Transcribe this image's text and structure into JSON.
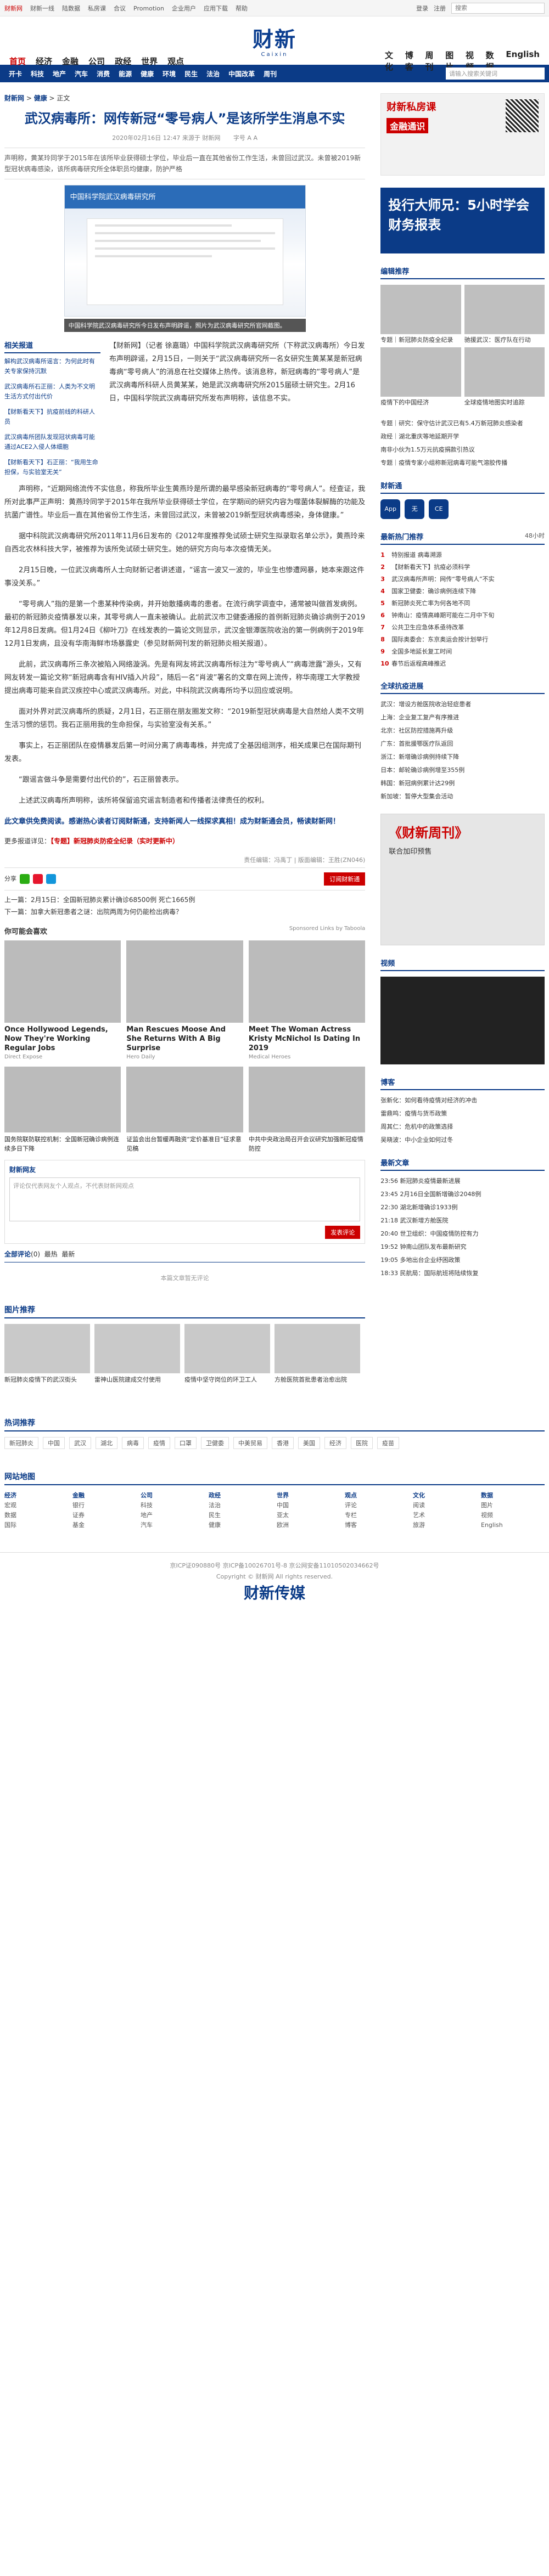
{
  "topbar": {
    "links": [
      "财新网",
      "财新一线",
      "陆数据",
      "私房课",
      "合议",
      "Promotion",
      "企业用户",
      "应用下载",
      "帮助"
    ],
    "login": "登录",
    "register": "注册",
    "search_placeholder": "搜索"
  },
  "logo": {
    "cn": "财新",
    "en": "Caixin"
  },
  "nav": {
    "left": [
      "首页",
      "经济",
      "金融",
      "公司",
      "政经",
      "世界",
      "观点"
    ],
    "right": [
      "文化",
      "博客",
      "周刊",
      "图片",
      "视频",
      "数据",
      "English"
    ]
  },
  "subnav": {
    "items": [
      "开卡",
      "科技",
      "地产",
      "汽车",
      "消费",
      "能源",
      "健康",
      "环境",
      "民生",
      "法治",
      "中国改革",
      "周刊"
    ],
    "search_placeholder": "请输入搜索关键词"
  },
  "crumb": {
    "site": "财新网",
    "sep1": " > ",
    "section": "健康",
    "sep2": " > ",
    "sub": "正文"
  },
  "article": {
    "title": "武汉病毒所：网传新冠“零号病人”是该所学生消息不实",
    "meta": "2020年02月16日 12:47 来源于 财新网",
    "zoom": "字号 A A",
    "summary": "声明称，黄某玲同学于2015年在该所毕业获得硕士学位，毕业后一直在其他省份工作生活，未曾回过武汉。未曾被2019新型冠状病毒感染，该所病毒研究所全体职员均健康，防护严格",
    "photo_banner": "中国科学院武汉病毒研究所",
    "caption": "中国科学院武汉病毒研究所今日发布声明辟谣，照片为武汉病毒研究所官网截图。",
    "lead": "【财新网】（记者 徐嘉璐）中国科学院武汉病毒研究所（下称武汉病毒所）今日发布声明辟谣，2月15日，一则关于“武汉病毒研究所一名女研究生黄某某是新冠病毒病“零号病人”的消息在社交媒体上热传。该消息称，新冠病毒的“零号病人”是武汉病毒所科研人员黄某某，她是武汉病毒研究所2015届硕士研究生。2月16日，中国科学院武汉病毒研究所发布声明称，该信息不实。",
    "paragraphs": [
      "声明称，“近期网络流传不实信息，称我所毕业生黄燕玲是所谓的最早感染新冠病毒的“零号病人”。经查证，我所对此事严正声明：黄燕玲同学于2015年在我所毕业获得硕士学位，在学期间的研究内容为噬菌体裂解酶的功能及抗菌广谱性。毕业后一直在其他省份工作生活，未曾回过武汉，未曾被2019新型冠状病毒感染，身体健康。”",
      "据中科院武汉病毒研究所2011年11月6日发布的《2012年度推荐免试硕士研究生拟录取名单公示》，黄燕玲来自西北农林科技大学，被推荐为该所免试硕士研究生。她的研究方向与本次疫情无关。",
      "2月15日晚，一位武汉病毒所人士向财新记者讲述道，“谣言一波又一波的，毕业生也惨遭网暴，她本来跟这件事没关系。”",
      "“零号病人”指的是第一个患某种传染病，并开始散播病毒的患者。在流行病学调查中，通常被叫做首发病例。最初的新冠肺炎疫情暴发以来，其零号病人一直未被确认。此前武汉市卫健委通报的首例新冠肺炎确诊病例于2019年12月8日发病。但1月24日《柳叶刀》在线发表的一篇论文则显示，武汉金银潭医院收治的第一例病例于2019年12月1日发病，且没有华南海鲜市场暴露史（参见财新网刊发的新冠肺炎相关报道）。",
      "此前，武汉病毒所三条次被陷入网络漩涡。先是有网友将武汉病毒所标注为“零号病人”“病毒泄露”源头，又有网友转发一篇论文称“新冠病毒含有HIV插入片段”，随后一名“肖波”署名的文章在网上流传，称华南理工大学教授提出病毒可能来自武汉疾控中心或武汉病毒所。对此，中科院武汉病毒所均予以回应或说明。",
      "面对外界对武汉病毒所的质疑，2月1日，石正丽在朋友圈发文称：“2019新型冠状病毒是大自然给人类不文明生活习惯的惩罚。我石正丽用我的生命担保，与实验室没有关系。”",
      "事实上，石正丽团队在疫情暴发后第一时间分离了病毒毒株，并完成了全基因组测序，相关成果已在国际期刊发表。",
      "“跟谣言做斗争是需要付出代价的”，石正丽曾表示。",
      "上述武汉病毒所声明称，该所将保留追究谣言制造者和传播者法律责任的权利。"
    ],
    "note": "此文章供免费阅读。感谢热心读者订阅财新通，支持新闻人一线探求真相！成为财新通会员，畅读财新网！",
    "more_label": "更多报道详见：",
    "more_link": "【专题】新冠肺炎防疫全纪录（实时更新中）",
    "editor": "责任编辑：冯禹丁 | 版面编辑：王胜(ZN046)",
    "share_label": "分享",
    "buy_label": "订阅财新通",
    "prev": "上一篇：2月15日：全国新冠肺炎累计确诊68500例 死亡1665例",
    "next": "下一篇：加拿大新冠患者之谜：出院两周为何仍能检出病毒？"
  },
  "related": {
    "title": "相关报道",
    "items": [
      "解构武汉病毒所谣言：为何此时有关专家保持沉默",
      "武汉病毒所石正丽：人类为不文明生活方式付出代价",
      "【财新看天下】抗疫前线的科研人员",
      "武汉病毒所团队发现冠状病毒可能通过ACE2入侵人体细胞",
      "【财新看天下】石正丽：“我用生命担保，与实验室无关”"
    ]
  },
  "maybe": {
    "title": "你可能会喜欢",
    "sponsor": "Sponsored Links by Taboola",
    "tiles": [
      {
        "t": "Once Hollywood Legends, Now They're Working Regular Jobs",
        "s": "Direct Expose"
      },
      {
        "t": "Man Rescues Moose And She Returns With A Big Surprise",
        "s": "Hero Daily"
      },
      {
        "t": "Meet The Woman Actress Kristy McNichol Is Dating In 2019",
        "s": "Medical Heroes"
      }
    ],
    "tiles2": [
      {
        "t": "国务院联防联控机制：全国新冠确诊病例连续多日下降"
      },
      {
        "t": "证监会出台暂缓再融资“定价基准日”征求意见稿"
      },
      {
        "t": "中共中央政治局召开会议研究加强新冠疫情防控"
      }
    ]
  },
  "comment": {
    "head": "财新网友",
    "placeholder": "评论仅代表网友个人观点，不代表财新网观点",
    "submit": "发表评论"
  },
  "all_comments": {
    "label": "全部评论",
    "count": "(0)",
    "tab2": "最热",
    "tab3": "最新"
  },
  "empty": "本篇文章暂无评论",
  "pictures": {
    "title": "图片推荐",
    "items": [
      "新冠肺炎疫情下的武汉街头",
      "雷神山医院建成交付使用",
      "疫情中坚守岗位的环卫工人",
      "方舱医院首批患者治愈出院"
    ]
  },
  "side": {
    "ad1_title": "财新私房课",
    "ad1_sub": "金融通识",
    "ad1_btn": "立即报名",
    "ad2": "投行大师兄：5小时学会财务报表",
    "picks_title": "编辑推荐",
    "picks": [
      "专题｜新冠肺炎防疫全纪录",
      "驰援武汉：医疗队在行动",
      "疫情下的中国经济",
      "全球疫情地图实时追踪"
    ],
    "list": [
      "专题｜研究：保守估计武汉已有5.4万新冠肺炎感染者",
      "政经｜湖北重庆等地延期开学",
      "南非小伙为1.5万元抗疫捐款引热议",
      "专题｜疫情专家小组称新冠病毒可能气溶胶传播"
    ],
    "app_title": "财新通",
    "apps": [
      "App",
      "无",
      "CE"
    ],
    "rank_title": "最新热门推荐",
    "rank_sub": "48小时",
    "rank": [
      "特别报道 病毒溯源",
      "【财新看天下】抗疫必须科学",
      "武汉病毒所声明：网传“零号病人”不实",
      "国家卫健委：确诊病例连续下降",
      "新冠肺炎死亡率为何各地不同",
      "钟南山：疫情高峰期可能在二月中下旬",
      "公共卫生应急体系亟待改革",
      "国际奥委会：东京奥运会按计划举行",
      "全国多地延长复工时间",
      "春节后返程高峰推迟"
    ],
    "mag_title": "《财新周刊》",
    "mag_sub": "联合加印预售",
    "news_title": "全球抗疫进展",
    "news": [
      "武汉：增设方舱医院收治轻症患者",
      "上海：企业复工复产有序推进",
      "北京：社区防控措施再升级",
      "广东：首批援鄂医疗队返回",
      "浙江：新增确诊病例持续下降",
      "日本：邮轮确诊病例增至355例",
      "韩国：新冠病例累计达29例",
      "新加坡：暂停大型集会活动"
    ],
    "video_title": "视频",
    "blog_title": "博客",
    "blogs": [
      "张新化：如何看待疫情对经济的冲击",
      "雷鼎鸣：疫情与货币政策",
      "周其仁：危机中的政策选择",
      "吴晓波：中小企业如何过冬"
    ],
    "latest_title": "最新文章",
    "latest": [
      "23:56 新冠肺炎疫情最新进展",
      "23:45 2月16日全国新增确诊2048例",
      "22:30 湖北新增确诊1933例",
      "21:18 武汉新增方舱医院",
      "20:40 世卫组织：中国疫情防控有力",
      "19:52 钟南山团队发布最新研究",
      "19:05 多地出台企业纾困政策",
      "18:33 民航局：国际航班将陆续恢复"
    ]
  },
  "hot": {
    "title": "热词推荐",
    "tags": [
      "新冠肺炎",
      "中国",
      "武汉",
      "湖北",
      "病毒",
      "疫情",
      "口罩",
      "卫健委",
      "中美贸易",
      "香港",
      "美国",
      "经济",
      "医院",
      "疫苗"
    ]
  },
  "sitemap": {
    "title": "网站地图",
    "cols": [
      [
        "经济",
        "宏观",
        "数据",
        "国际"
      ],
      [
        "金融",
        "银行",
        "证券",
        "基金"
      ],
      [
        "公司",
        "科技",
        "地产",
        "汽车"
      ],
      [
        "政经",
        "法治",
        "民生",
        "健康"
      ],
      [
        "世界",
        "中国",
        "亚太",
        "欧洲"
      ],
      [
        "观点",
        "评论",
        "专栏",
        "博客"
      ],
      [
        "文化",
        "阅读",
        "艺术",
        "旅游"
      ],
      [
        "数据",
        "图片",
        "视频",
        "English"
      ]
    ]
  },
  "footer": {
    "line1": "京ICP证090880号 京ICP备10026701号-8 京公网安备11010502034662号",
    "line2": "Copyright © 财新网 All rights reserved.",
    "logo": "财新传媒"
  }
}
